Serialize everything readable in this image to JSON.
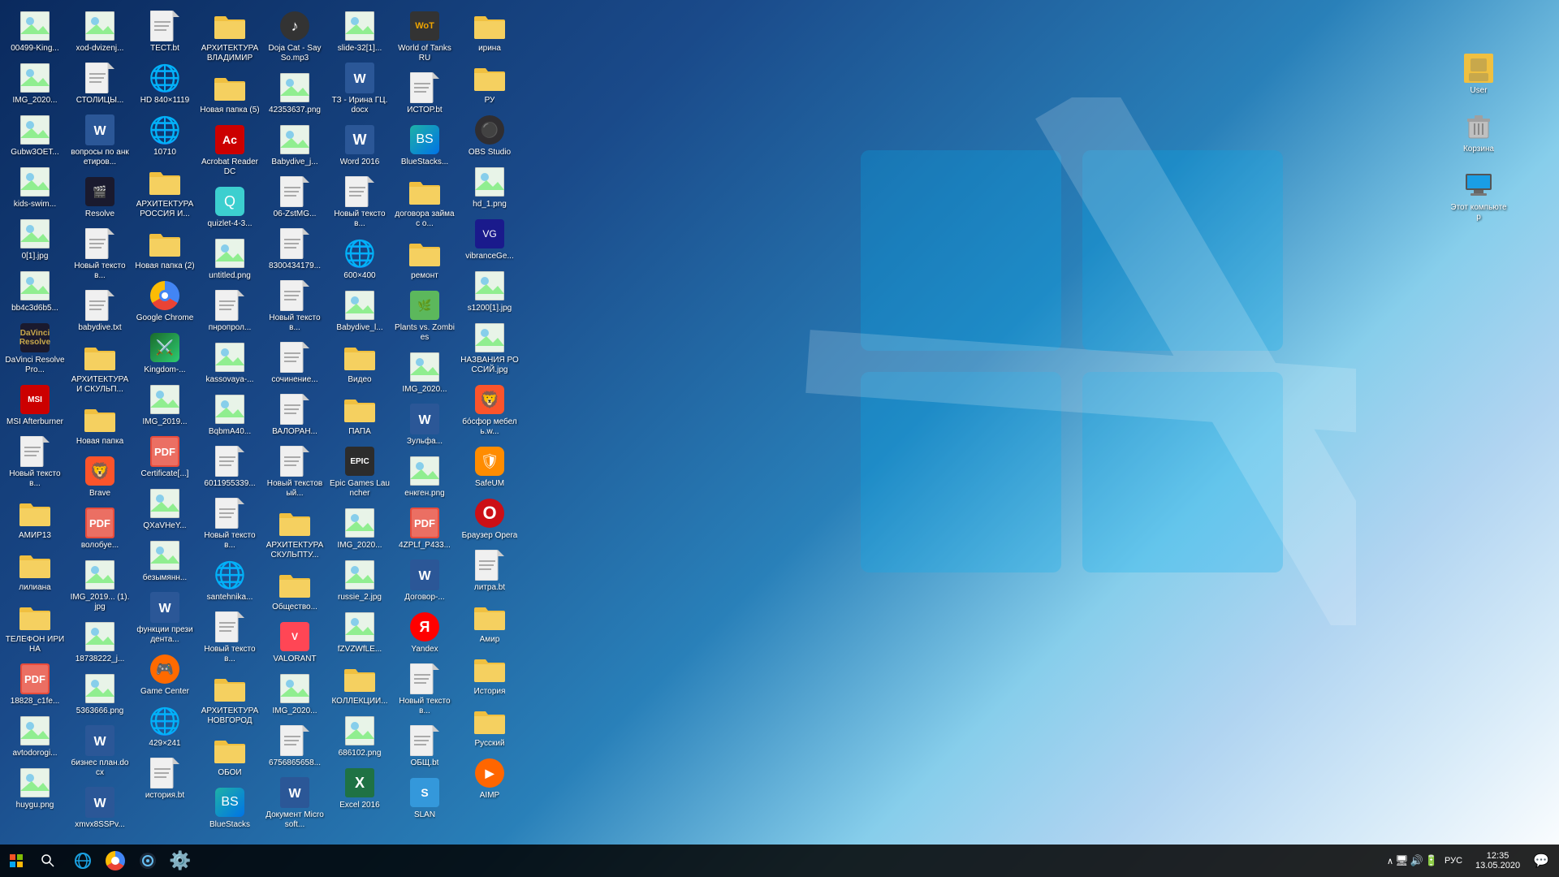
{
  "desktop": {
    "bg_gradient": "windows10-blue",
    "icons": [
      {
        "id": "icon-1",
        "label": "00499-King...",
        "type": "image",
        "emoji": "🖼️"
      },
      {
        "id": "icon-2",
        "label": "IMG_2020...",
        "type": "image",
        "emoji": "🖼️"
      },
      {
        "id": "icon-3",
        "label": "Gubw3OET...",
        "type": "image",
        "emoji": "🖼️"
      },
      {
        "id": "icon-4",
        "label": "kids-swim...",
        "type": "image",
        "emoji": "🖼️"
      },
      {
        "id": "icon-5",
        "label": "0[1].jpg",
        "type": "jpg",
        "emoji": "🖼️"
      },
      {
        "id": "icon-6",
        "label": "bb4c3d6b5...",
        "type": "image",
        "emoji": "🖼️"
      },
      {
        "id": "icon-7",
        "label": "DaVinci Resolve Pro...",
        "type": "app",
        "special": "davinci"
      },
      {
        "id": "icon-8",
        "label": "MSI Afterburner",
        "type": "app",
        "special": "msi"
      },
      {
        "id": "icon-9",
        "label": "Новый текстов...",
        "type": "txt",
        "emoji": "📄"
      },
      {
        "id": "icon-10",
        "label": "АМИР13",
        "type": "folder",
        "emoji": "📁"
      },
      {
        "id": "icon-11",
        "label": "лилиана",
        "type": "folder",
        "emoji": "📁"
      },
      {
        "id": "icon-12",
        "label": "ТЕЛЕФОН ИРИНА",
        "type": "folder",
        "emoji": "📁"
      },
      {
        "id": "icon-13",
        "label": "18828_c1fe...",
        "type": "pdf",
        "emoji": "📋"
      },
      {
        "id": "icon-14",
        "label": "avtodorogi...",
        "type": "png",
        "emoji": "🖼️"
      },
      {
        "id": "icon-15",
        "label": "huygu.png",
        "type": "png",
        "emoji": "🖼️"
      },
      {
        "id": "icon-16",
        "label": "xod-dvizenj...",
        "type": "image",
        "emoji": "🖼️"
      },
      {
        "id": "icon-17",
        "label": "СТОЛИЦЫ...",
        "type": "txt",
        "emoji": "📄"
      },
      {
        "id": "icon-18",
        "label": "вопросы по анкетиров...",
        "type": "word",
        "emoji": "📝"
      },
      {
        "id": "icon-19",
        "label": "Resolve",
        "type": "app",
        "special": "resolve"
      },
      {
        "id": "icon-20",
        "label": "Новый текстов...",
        "type": "txt",
        "emoji": "📄"
      },
      {
        "id": "icon-21",
        "label": "babydive.txt",
        "type": "txt",
        "emoji": "📄"
      },
      {
        "id": "icon-22",
        "label": "АРХИТЕКТУРА И СКУЛЬП...",
        "type": "folder",
        "emoji": "📁"
      },
      {
        "id": "icon-23",
        "label": "Новая папка",
        "type": "folder",
        "emoji": "📁"
      },
      {
        "id": "icon-24",
        "label": "Brave",
        "type": "app",
        "special": "brave"
      },
      {
        "id": "icon-25",
        "label": "волобуе...",
        "type": "pdf",
        "emoji": "📋"
      },
      {
        "id": "icon-26",
        "label": "IMG_2019... (1).jpg",
        "type": "jpg",
        "emoji": "🖼️"
      },
      {
        "id": "icon-27",
        "label": "18738222_j...",
        "type": "jpg",
        "emoji": "🖼️"
      },
      {
        "id": "icon-28",
        "label": "5363666.png",
        "type": "png",
        "emoji": "🖼️"
      },
      {
        "id": "icon-29",
        "label": "бизнес план.docx",
        "type": "word",
        "emoji": "📝"
      },
      {
        "id": "icon-30",
        "label": "xmvx8SSPv...",
        "type": "word",
        "emoji": "📝"
      },
      {
        "id": "icon-31",
        "label": "ТЕСТ.bt",
        "type": "txt",
        "emoji": "📄"
      },
      {
        "id": "icon-32",
        "label": "HD 840×1119",
        "type": "ie",
        "special": "ie"
      },
      {
        "id": "icon-33",
        "label": "10710",
        "type": "ie",
        "special": "ie"
      },
      {
        "id": "icon-34",
        "label": "АРХИТЕКТУРА РОССИЯ И...",
        "type": "folder",
        "emoji": "📁"
      },
      {
        "id": "icon-35",
        "label": "Новая папка (2)",
        "type": "folder",
        "emoji": "📁"
      },
      {
        "id": "icon-36",
        "label": "Google Chrome",
        "type": "app",
        "special": "chrome"
      },
      {
        "id": "icon-37",
        "label": "Kingdom-...",
        "type": "app",
        "special": "kingdomrush"
      },
      {
        "id": "icon-38",
        "label": "IMG_2019...",
        "type": "jpg",
        "emoji": "🖼️"
      },
      {
        "id": "icon-39",
        "label": "Certificate[...]",
        "type": "pdf",
        "emoji": "📋"
      },
      {
        "id": "icon-40",
        "label": "QXaVHeY...",
        "type": "jpg",
        "emoji": "🖼️"
      },
      {
        "id": "icon-41",
        "label": "безымянн...",
        "type": "image",
        "emoji": "🖼️"
      },
      {
        "id": "icon-42",
        "label": "функции президента...",
        "type": "word",
        "emoji": "📝"
      },
      {
        "id": "icon-43",
        "label": "Game Center",
        "type": "app",
        "special": "game-center"
      },
      {
        "id": "icon-44",
        "label": "429×241",
        "type": "ie",
        "special": "ie"
      },
      {
        "id": "icon-45",
        "label": "история.bt",
        "type": "txt",
        "emoji": "📄"
      },
      {
        "id": "icon-46",
        "label": "АРХИТЕКТУРА ВЛАДИМИР",
        "type": "folder",
        "emoji": "📁"
      },
      {
        "id": "icon-47",
        "label": "Новая папка (5)",
        "type": "folder",
        "emoji": "📁"
      },
      {
        "id": "icon-48",
        "label": "Acrobat Reader DC",
        "type": "app",
        "special": "acrobat"
      },
      {
        "id": "icon-49",
        "label": "quizlet-4-3...",
        "type": "app",
        "special": "quizlet"
      },
      {
        "id": "icon-50",
        "label": "untitled.png",
        "type": "png",
        "emoji": "🖼️"
      },
      {
        "id": "icon-51",
        "label": "пнропрол...",
        "type": "txt",
        "emoji": "📄"
      },
      {
        "id": "icon-52",
        "label": "kassovaya-...",
        "type": "image",
        "emoji": "🖼️"
      },
      {
        "id": "icon-53",
        "label": "BqbmA40...",
        "type": "image",
        "emoji": "🖼️"
      },
      {
        "id": "icon-54",
        "label": "6011955339...",
        "type": "txt",
        "emoji": "📄"
      },
      {
        "id": "icon-55",
        "label": "Новый текстов...",
        "type": "txt",
        "emoji": "📄"
      },
      {
        "id": "icon-56",
        "label": "santehnika...",
        "type": "ie",
        "special": "ie"
      },
      {
        "id": "icon-57",
        "label": "Новый текстов...",
        "type": "txt",
        "emoji": "📄"
      },
      {
        "id": "icon-58",
        "label": "АРХИТЕКТУРА НОВГОРОД",
        "type": "folder",
        "emoji": "📁"
      },
      {
        "id": "icon-59",
        "label": "ОБОИ",
        "type": "folder",
        "emoji": "📁"
      },
      {
        "id": "icon-60",
        "label": "BlueStacks",
        "type": "app",
        "special": "bluestacks"
      },
      {
        "id": "icon-61",
        "label": "Doja Cat - Say So.mp3",
        "type": "app",
        "special": "doja"
      },
      {
        "id": "icon-62",
        "label": "42353637.png",
        "type": "png",
        "emoji": "🖼️"
      },
      {
        "id": "icon-63",
        "label": "Babydive_j...",
        "type": "jpg",
        "emoji": "🖼️"
      },
      {
        "id": "icon-64",
        "label": "06-ZstMG...",
        "type": "txt",
        "emoji": "📄"
      },
      {
        "id": "icon-65",
        "label": "8300434179...",
        "type": "txt",
        "emoji": "📄"
      },
      {
        "id": "icon-66",
        "label": "Новый текстов...",
        "type": "txt",
        "emoji": "📄"
      },
      {
        "id": "icon-67",
        "label": "сочинение...",
        "type": "txt",
        "emoji": "📄"
      },
      {
        "id": "icon-68",
        "label": "ВАЛОРАН...",
        "type": "txt",
        "emoji": "📄"
      },
      {
        "id": "icon-69",
        "label": "Новый текстовый...",
        "type": "txt",
        "emoji": "📄"
      },
      {
        "id": "icon-70",
        "label": "АРХИТЕКТУРА СКУЛЬПТУ...",
        "type": "folder",
        "emoji": "📁"
      },
      {
        "id": "icon-71",
        "label": "Общество...",
        "type": "folder",
        "emoji": "📁"
      },
      {
        "id": "icon-72",
        "label": "VALORANT",
        "type": "app",
        "special": "valorant"
      },
      {
        "id": "icon-73",
        "label": "IMG_2020...",
        "type": "jpg",
        "emoji": "🖼️"
      },
      {
        "id": "icon-74",
        "label": "6756865658...",
        "type": "txt",
        "emoji": "📄"
      },
      {
        "id": "icon-75",
        "label": "Документ Microsoft...",
        "type": "word",
        "emoji": "📝"
      },
      {
        "id": "icon-76",
        "label": "slide-32[1]...",
        "type": "jpg",
        "emoji": "🖼️"
      },
      {
        "id": "icon-77",
        "label": "ТЗ - Ирина ГЦ.docx",
        "type": "word",
        "emoji": "📝"
      },
      {
        "id": "icon-78",
        "label": "Word 2016",
        "type": "word",
        "special": "word2016"
      },
      {
        "id": "icon-79",
        "label": "Новый текстов...",
        "type": "txt",
        "emoji": "📄"
      },
      {
        "id": "icon-80",
        "label": "600×400",
        "type": "ie",
        "special": "ie"
      },
      {
        "id": "icon-81",
        "label": "Babydive_l...",
        "type": "jpg",
        "emoji": "🖼️"
      },
      {
        "id": "icon-82",
        "label": "Видео",
        "type": "folder",
        "emoji": "📁"
      },
      {
        "id": "icon-83",
        "label": "ПАПА",
        "type": "folder",
        "emoji": "📁"
      },
      {
        "id": "icon-84",
        "label": "Epic Games Launcher",
        "type": "app",
        "special": "epic"
      },
      {
        "id": "icon-85",
        "label": "IMG_2020...",
        "type": "jpg",
        "emoji": "🖼️"
      },
      {
        "id": "icon-86",
        "label": "russie_2.jpg",
        "type": "jpg",
        "emoji": "🖼️"
      },
      {
        "id": "icon-87",
        "label": "fZVZWfLE...",
        "type": "jpg",
        "emoji": "🖼️"
      },
      {
        "id": "icon-88",
        "label": "КОЛЛЕКЦИИ...",
        "type": "folder",
        "emoji": "📁"
      },
      {
        "id": "icon-89",
        "label": "686102.png",
        "type": "png",
        "emoji": "🖼️"
      },
      {
        "id": "icon-90",
        "label": "Excel 2016",
        "type": "app",
        "special": "excel2016"
      },
      {
        "id": "icon-91",
        "label": "World of Tanks RU",
        "type": "app",
        "special": "wot"
      },
      {
        "id": "icon-92",
        "label": "ИСТОР.bt",
        "type": "txt",
        "emoji": "📄"
      },
      {
        "id": "icon-93",
        "label": "BlueStacks...",
        "type": "app",
        "special": "bluestacks"
      },
      {
        "id": "icon-94",
        "label": "договора займа с о...",
        "type": "folder",
        "emoji": "📁"
      },
      {
        "id": "icon-95",
        "label": "ремонт",
        "type": "folder",
        "emoji": "📁"
      },
      {
        "id": "icon-96",
        "label": "Plants vs. Zombies",
        "type": "app",
        "special": "plants"
      },
      {
        "id": "icon-97",
        "label": "IMG_2020...",
        "type": "jpg",
        "emoji": "🖼️"
      },
      {
        "id": "icon-98",
        "label": "Зульфа...",
        "type": "word",
        "emoji": "📝"
      },
      {
        "id": "icon-99",
        "label": "енкген.png",
        "type": "png",
        "emoji": "🖼️"
      },
      {
        "id": "icon-100",
        "label": "4ZPLf_P433...",
        "type": "pdf",
        "emoji": "📋"
      },
      {
        "id": "icon-101",
        "label": "Договор-...",
        "type": "word",
        "emoji": "📝"
      },
      {
        "id": "icon-102",
        "label": "Yandex",
        "type": "app",
        "special": "yandex"
      },
      {
        "id": "icon-103",
        "label": "Новый текстов...",
        "type": "txt",
        "emoji": "📄"
      },
      {
        "id": "icon-104",
        "label": "ОБЩ.bt",
        "type": "txt",
        "emoji": "📄"
      },
      {
        "id": "icon-105",
        "label": "SLAN",
        "type": "app",
        "special": "slan"
      },
      {
        "id": "icon-106",
        "label": "ирина",
        "type": "folder",
        "emoji": "📁"
      },
      {
        "id": "icon-107",
        "label": "РУ",
        "type": "folder",
        "emoji": "📁"
      },
      {
        "id": "icon-108",
        "label": "OBS Studio",
        "type": "app",
        "special": "obs"
      },
      {
        "id": "icon-109",
        "label": "hd_1.png",
        "type": "png",
        "emoji": "🖼️"
      },
      {
        "id": "icon-110",
        "label": "vibranceGe...",
        "type": "app",
        "special": "vibrancegui"
      },
      {
        "id": "icon-111",
        "label": "s1200[1].jpg",
        "type": "jpg",
        "emoji": "🖼️"
      },
      {
        "id": "icon-112",
        "label": "НАЗВАНИЯ РОССИЙ.jpg",
        "type": "jpg",
        "emoji": "🖼️"
      },
      {
        "id": "icon-113",
        "label": "бо́сфор мебель.w...",
        "type": "app",
        "special": "brave"
      },
      {
        "id": "icon-114",
        "label": "SafeUM",
        "type": "app",
        "special": "safeup"
      },
      {
        "id": "icon-115",
        "label": "Браузер Opera",
        "type": "app",
        "special": "opera"
      },
      {
        "id": "icon-116",
        "label": "литра.bt",
        "type": "txt",
        "emoji": "📄"
      },
      {
        "id": "icon-117",
        "label": "Амир",
        "type": "folder",
        "emoji": "📁"
      },
      {
        "id": "icon-118",
        "label": "История",
        "type": "folder",
        "emoji": "📁"
      },
      {
        "id": "icon-119",
        "label": "Русский",
        "type": "folder",
        "emoji": "📁"
      },
      {
        "id": "icon-120",
        "label": "AIMP",
        "type": "app",
        "special": "aimp"
      }
    ],
    "right_icons": [
      {
        "id": "right-1",
        "label": "User",
        "type": "folder-user",
        "emoji": "👤"
      },
      {
        "id": "right-2",
        "label": "Корзина",
        "type": "trash",
        "emoji": "🗑️"
      },
      {
        "id": "right-3",
        "label": "Этот компьютер",
        "type": "computer",
        "emoji": "💻"
      }
    ]
  },
  "taskbar": {
    "start_label": "Start",
    "search_placeholder": "Search",
    "time": "12:35",
    "date": "13.05.2020",
    "lang": "РУС",
    "tray_items": [
      "chevron",
      "network",
      "volume",
      "battery",
      "notification"
    ]
  }
}
